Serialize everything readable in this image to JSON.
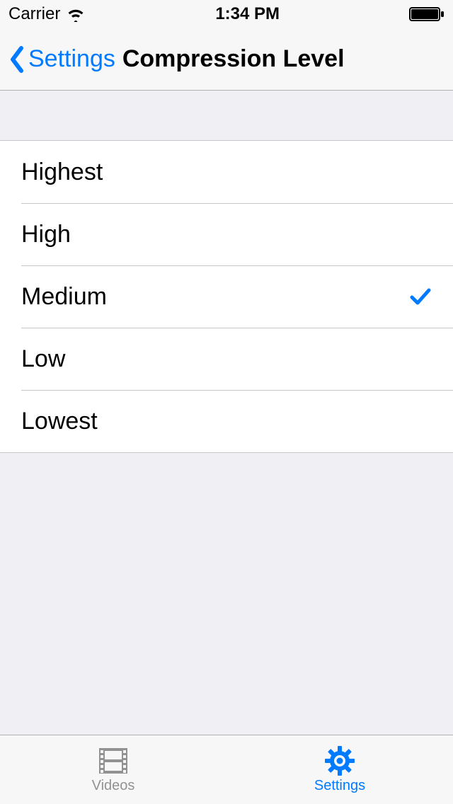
{
  "statusbar": {
    "carrier": "Carrier",
    "time": "1:34 PM"
  },
  "nav": {
    "back_label": "Settings",
    "title": "Compression Level"
  },
  "options": [
    {
      "label": "Highest",
      "selected": false
    },
    {
      "label": "High",
      "selected": false
    },
    {
      "label": "Medium",
      "selected": true
    },
    {
      "label": "Low",
      "selected": false
    },
    {
      "label": "Lowest",
      "selected": false
    }
  ],
  "tabs": {
    "videos": {
      "label": "Videos",
      "active": false
    },
    "settings": {
      "label": "Settings",
      "active": true
    }
  },
  "colors": {
    "tint": "#007aff",
    "inactive": "#929292",
    "bg": "#efeff4",
    "bar": "#f7f7f7",
    "separator": "#c8c7cc"
  }
}
